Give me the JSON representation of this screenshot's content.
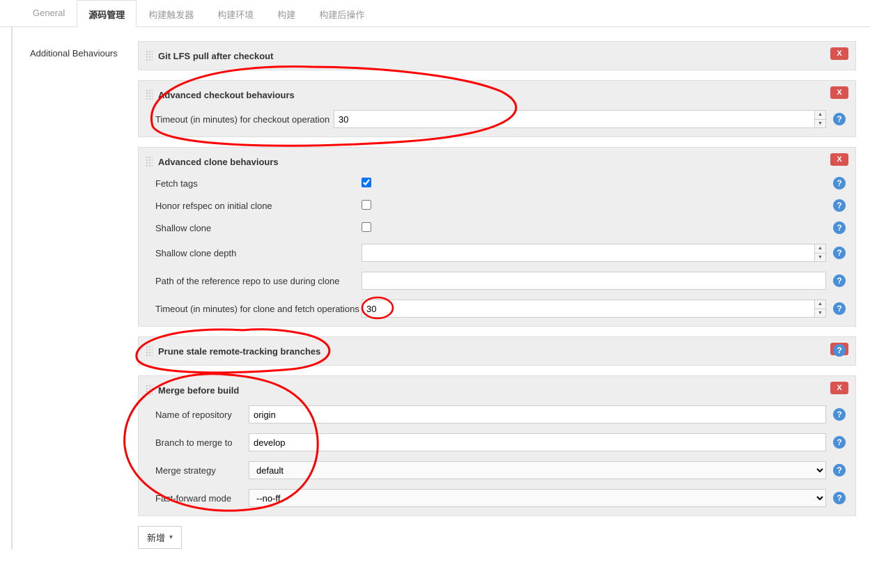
{
  "tabs": {
    "general": "General",
    "scm": "源码管理",
    "triggers": "构建触发器",
    "env": "构建环境",
    "build": "构建",
    "post": "构建后操作"
  },
  "side": {
    "additional_behaviours": "Additional Behaviours"
  },
  "sections": {
    "lfs": {
      "title": "Git LFS pull after checkout"
    },
    "adv_checkout": {
      "title": "Advanced checkout behaviours",
      "timeout_label": "Timeout (in minutes) for checkout operation",
      "timeout_value": "30"
    },
    "adv_clone": {
      "title": "Advanced clone behaviours",
      "fetch_tags_label": "Fetch tags",
      "fetch_tags_checked": true,
      "honor_refspec_label": "Honor refspec on initial clone",
      "honor_refspec_checked": false,
      "shallow_clone_label": "Shallow clone",
      "shallow_clone_checked": false,
      "shallow_depth_label": "Shallow clone depth",
      "shallow_depth_value": "",
      "ref_repo_label": "Path of the reference repo to use during clone",
      "ref_repo_value": "",
      "timeout_label": "Timeout (in minutes) for clone and fetch operations",
      "timeout_value": "30"
    },
    "prune": {
      "title": "Prune stale remote-tracking branches"
    },
    "merge": {
      "title": "Merge before build",
      "repo_label": "Name of repository",
      "repo_value": "origin",
      "branch_label": "Branch to merge to",
      "branch_value": "develop",
      "strategy_label": "Merge strategy",
      "strategy_value": "default",
      "ff_label": "Fast-forward mode",
      "ff_value": "--no-ff"
    }
  },
  "buttons": {
    "delete": "X",
    "add": "新增"
  },
  "icons": {
    "help": "?"
  }
}
